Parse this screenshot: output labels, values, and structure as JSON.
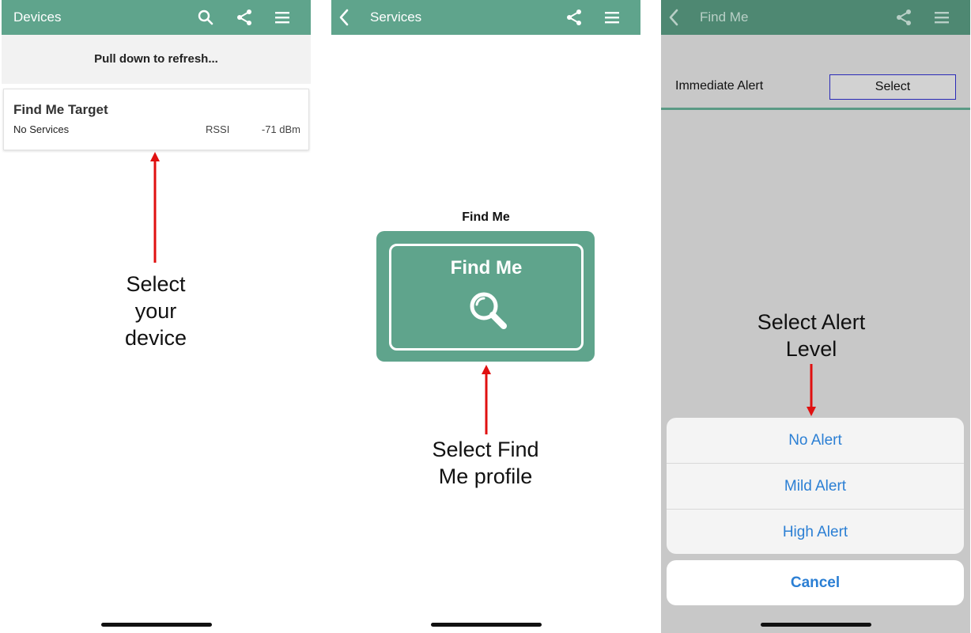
{
  "panel1": {
    "title": "Devices",
    "refresh_text": "Pull down to refresh...",
    "device": {
      "name": "Find Me Target",
      "services": "No Services",
      "rssi_label": "RSSI",
      "rssi_value": "-71 dBm"
    },
    "annotation": [
      "Select",
      "your",
      "device"
    ]
  },
  "panel2": {
    "title": "Services",
    "service_label": "Find Me",
    "service_card_title": "Find Me",
    "annotation": [
      "Select Find",
      "Me profile"
    ]
  },
  "panel3": {
    "title": "Find Me",
    "alert_label": "Immediate Alert",
    "select_label": "Select",
    "annotation": [
      "Select Alert",
      "Level"
    ],
    "options": [
      "No Alert",
      "Mild Alert",
      "High Alert"
    ],
    "cancel_label": "Cancel"
  },
  "colors": {
    "navbar": "#5fa48c",
    "annotation_arrow": "#e01010",
    "action_blue": "#2b7fd4"
  },
  "icons": [
    "search-icon",
    "share-icon",
    "menu-icon",
    "back-icon",
    "magnifier-icon"
  ]
}
